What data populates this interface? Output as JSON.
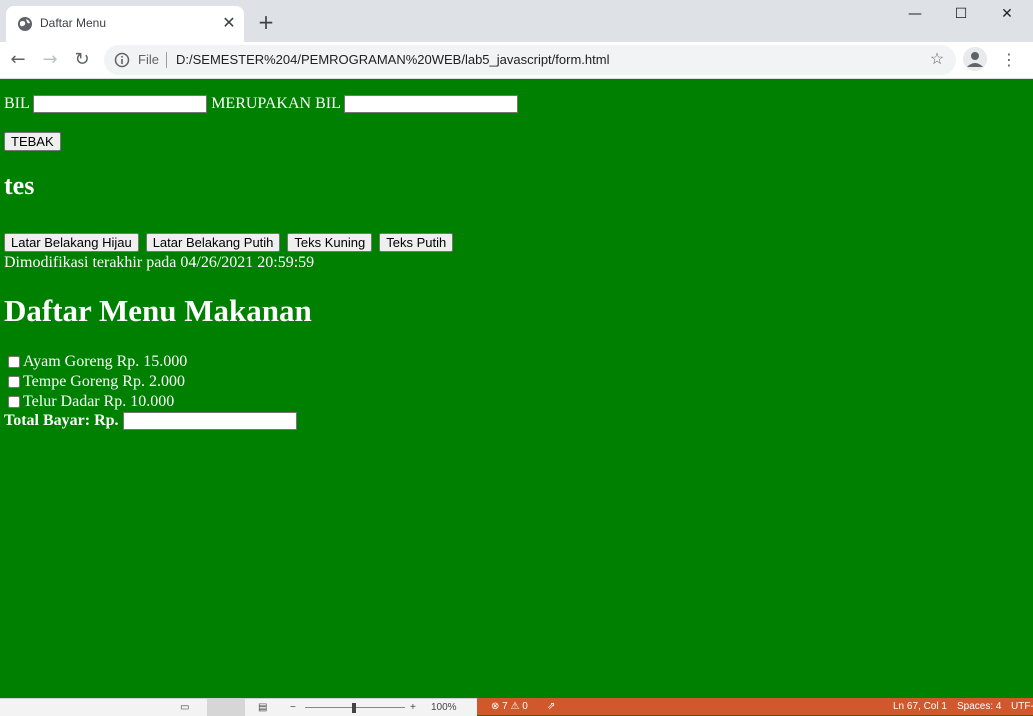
{
  "browser": {
    "tab_title": "Daftar Menu",
    "site_label": "File",
    "url": "D:/SEMESTER%204/PEMROGRAMAN%20WEB/lab5_javascript/form.html"
  },
  "form": {
    "bil_label": "BIL",
    "merupakan_label": "MERUPAKAN BIL",
    "bil_value": "",
    "result_value": "",
    "tebak_label": "TEBAK"
  },
  "heading_tes": "tes",
  "color_buttons": {
    "hijau": "Latar Belakang Hijau",
    "putih": "Latar Belakang Putih",
    "kuning": "Teks Kuning",
    "teks_putih": "Teks Putih"
  },
  "modified": "Dimodifikasi terakhir pada 04/26/2021 20:59:59",
  "menu": {
    "title": "Daftar Menu Makanan",
    "items": [
      {
        "label": "Ayam Goreng Rp. 15.000",
        "checked": false
      },
      {
        "label": "Tempe Goreng Rp. 2.000",
        "checked": false
      },
      {
        "label": "Telur Dadar Rp. 10.000",
        "checked": false
      }
    ],
    "total_label": "Total Bayar: Rp.",
    "total_value": ""
  },
  "word_status": {
    "zoom": "100%"
  },
  "vscode_status": {
    "errors": "7",
    "warnings": "0",
    "position": "Ln 67, Col 1",
    "spaces": "Spaces: 4",
    "encoding": "UTF-"
  },
  "colors": {
    "page_bg": "#008000",
    "vscode_status_bg": "#d1582c"
  }
}
